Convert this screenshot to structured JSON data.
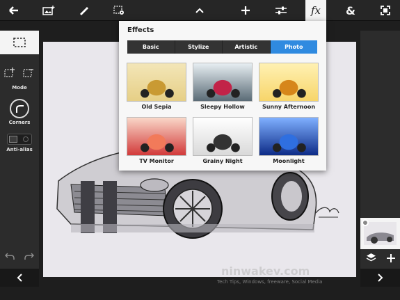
{
  "toolbar": {
    "buttons": [
      {
        "name": "back-button",
        "icon": "back-arrow-icon",
        "glyph": "🡐"
      },
      {
        "name": "add-image-button",
        "icon": "add-image-icon",
        "glyph": "▣"
      },
      {
        "name": "brush-button",
        "icon": "brush-icon",
        "glyph": "✎"
      },
      {
        "name": "selection-settings-button",
        "icon": "selection-settings-icon",
        "glyph": "⬚"
      },
      {
        "name": "collapse-button",
        "icon": "chevron-up-icon",
        "glyph": "⌃"
      },
      {
        "name": "add-button",
        "icon": "plus-icon",
        "glyph": "✛"
      },
      {
        "name": "adjustments-button",
        "icon": "sliders-icon",
        "glyph": "☰"
      },
      {
        "name": "effects-button",
        "icon": "fx-icon",
        "glyph": "fx"
      },
      {
        "name": "blend-button",
        "icon": "ampersand-icon",
        "glyph": "&"
      },
      {
        "name": "fit-screen-button",
        "icon": "fit-screen-icon",
        "glyph": "⛶"
      }
    ]
  },
  "left_panel": {
    "mode_label": "Mode",
    "corners_label": "Corners",
    "antialias_label": "Anti-alias"
  },
  "effects_panel": {
    "title": "Effects",
    "tabs": [
      "Basic",
      "Stylize",
      "Artistic",
      "Photo"
    ],
    "selected_tab": "Photo",
    "effects": [
      {
        "name": "Old Sepia",
        "colors": [
          "#e6cf86",
          "#c99a33",
          "#f3e6b8"
        ]
      },
      {
        "name": "Sleepy Hollow",
        "colors": [
          "#5a6b76",
          "#c22348",
          "#e7eef2"
        ]
      },
      {
        "name": "Sunny Afternoon",
        "colors": [
          "#f7d56a",
          "#d6861a",
          "#fff1b3"
        ]
      },
      {
        "name": "TV Monitor",
        "colors": [
          "#d23a3a",
          "#f27a5a",
          "#f9d7c8"
        ]
      },
      {
        "name": "Grainy Night",
        "colors": [
          "#d9d9d9",
          "#333333",
          "#ffffff"
        ]
      },
      {
        "name": "Moonlight",
        "colors": [
          "#0d2b87",
          "#2f6fe0",
          "#7fb0ff"
        ]
      }
    ]
  },
  "canvas": {
    "watermark": "ninwakev.com",
    "watermark_tagline": "Tech Tips, Windows, freeware, Social Media"
  },
  "colors": {
    "accent": "#2f8ae0",
    "toolbar_bg": "#262626",
    "panel_bg": "#f7f7f7"
  }
}
